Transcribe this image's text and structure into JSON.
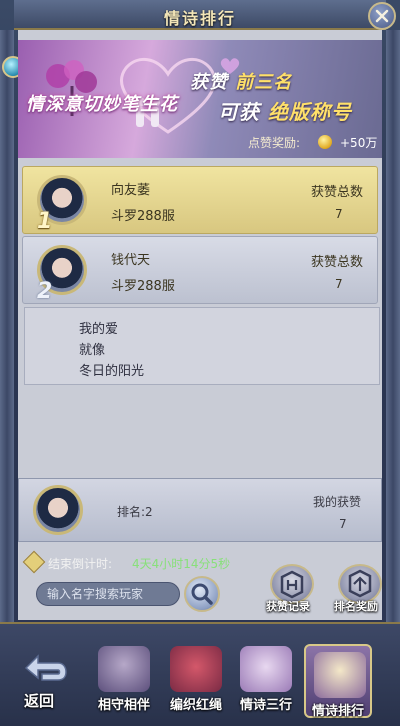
{
  "header": {
    "title": "情诗排行"
  },
  "banner": {
    "logo_text": "情深意切妙笔生花",
    "line1_prefix": "获赞",
    "line1_highlight": "前三名",
    "line2_prefix": "可获",
    "line2_highlight": "绝版称号",
    "reward_label": "点赞奖励:",
    "reward_value": "+50万"
  },
  "ranking": {
    "rows": [
      {
        "rank": "1",
        "name": "向友萎",
        "server": "斗罗288服",
        "likes_label": "获赞总数",
        "likes": "7"
      },
      {
        "rank": "2",
        "name": "钱代天",
        "server": "斗罗288服",
        "likes_label": "获赞总数",
        "likes": "7"
      }
    ],
    "poem_lines": [
      "我的爱",
      "就像",
      "冬日的阳光"
    ]
  },
  "my_info": {
    "rank_text": "排名:2",
    "likes_label": "我的获赞",
    "likes": "7"
  },
  "countdown": {
    "label": "结束倒计时:",
    "value": "4天4小时14分5秒"
  },
  "search": {
    "placeholder": "输入名字搜索玩家"
  },
  "side_buttons": [
    {
      "label": "获赞记录"
    },
    {
      "label": "排名奖励"
    }
  ],
  "bottom_nav": {
    "back_label": "返回",
    "tabs": [
      {
        "label": "相守相伴"
      },
      {
        "label": "编织红绳"
      },
      {
        "label": "情诗三行"
      },
      {
        "label": "情诗排行"
      }
    ]
  },
  "colors": {
    "accent_gold": "#c9b878",
    "countdown_green": "#88e07a",
    "banner_highlight": "#ffe06a"
  }
}
